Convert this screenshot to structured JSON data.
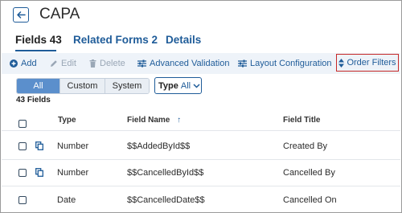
{
  "header": {
    "title": "CAPA"
  },
  "tabs": [
    {
      "label": "Fields",
      "count": "43"
    },
    {
      "label": "Related Forms",
      "count": "2"
    },
    {
      "label": "Details",
      "count": ""
    }
  ],
  "toolbar": {
    "add": "Add",
    "edit": "Edit",
    "delete": "Delete",
    "advanced_validation": "Advanced Validation",
    "layout_configuration": "Layout Configuration",
    "order_filters": "Order Filters"
  },
  "filters": {
    "segments": [
      "All",
      "Custom",
      "System"
    ],
    "type_label": "Type",
    "type_value": "All"
  },
  "field_count": "43 Fields",
  "table": {
    "columns": [
      "Type",
      "Field Name",
      "Field Title"
    ],
    "sort_indicator": "↑",
    "rows": [
      {
        "type": "Number",
        "field_name": "$$AddedById$$",
        "field_title": "Created By"
      },
      {
        "type": "Number",
        "field_name": "$$CancelledById$$",
        "field_title": "Cancelled By"
      },
      {
        "type": "Date",
        "field_name": "$$CancelledDate$$",
        "field_title": "Cancelled On"
      }
    ]
  },
  "colors": {
    "accent": "#1f5c99",
    "toolbar_bg": "#eef3f9",
    "highlight_border": "#c62828",
    "segment_active": "#5b8fcc"
  }
}
